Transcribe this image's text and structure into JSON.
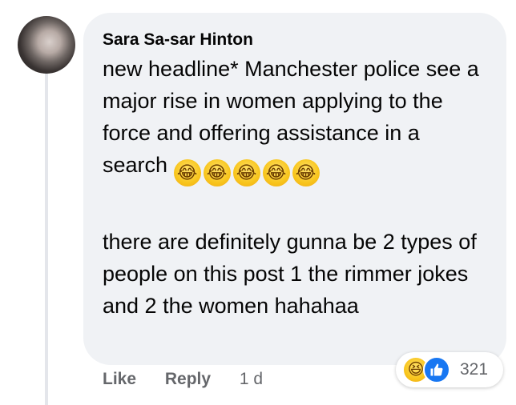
{
  "comment": {
    "author": "Sara Sa-sar Hinton",
    "paragraphs": [
      "new headline* Manchester police see a major rise in women applying to the force and offering assistance in a search",
      "there are definitely gunna be 2 types of people on this post 1 the rimmer jokes and 2 the women hahahaa"
    ],
    "emojis": [
      "😂",
      "😂",
      "😂",
      "😂",
      "😂"
    ]
  },
  "reactions": {
    "icons": [
      "haha-icon",
      "like-icon"
    ],
    "count": "321"
  },
  "actions": {
    "like_label": "Like",
    "reply_label": "Reply",
    "timestamp": "1 d"
  },
  "colors": {
    "bubble": "#f0f2f5",
    "text": "#050505",
    "secondary": "#65676b",
    "like_blue": "#1877f2"
  }
}
